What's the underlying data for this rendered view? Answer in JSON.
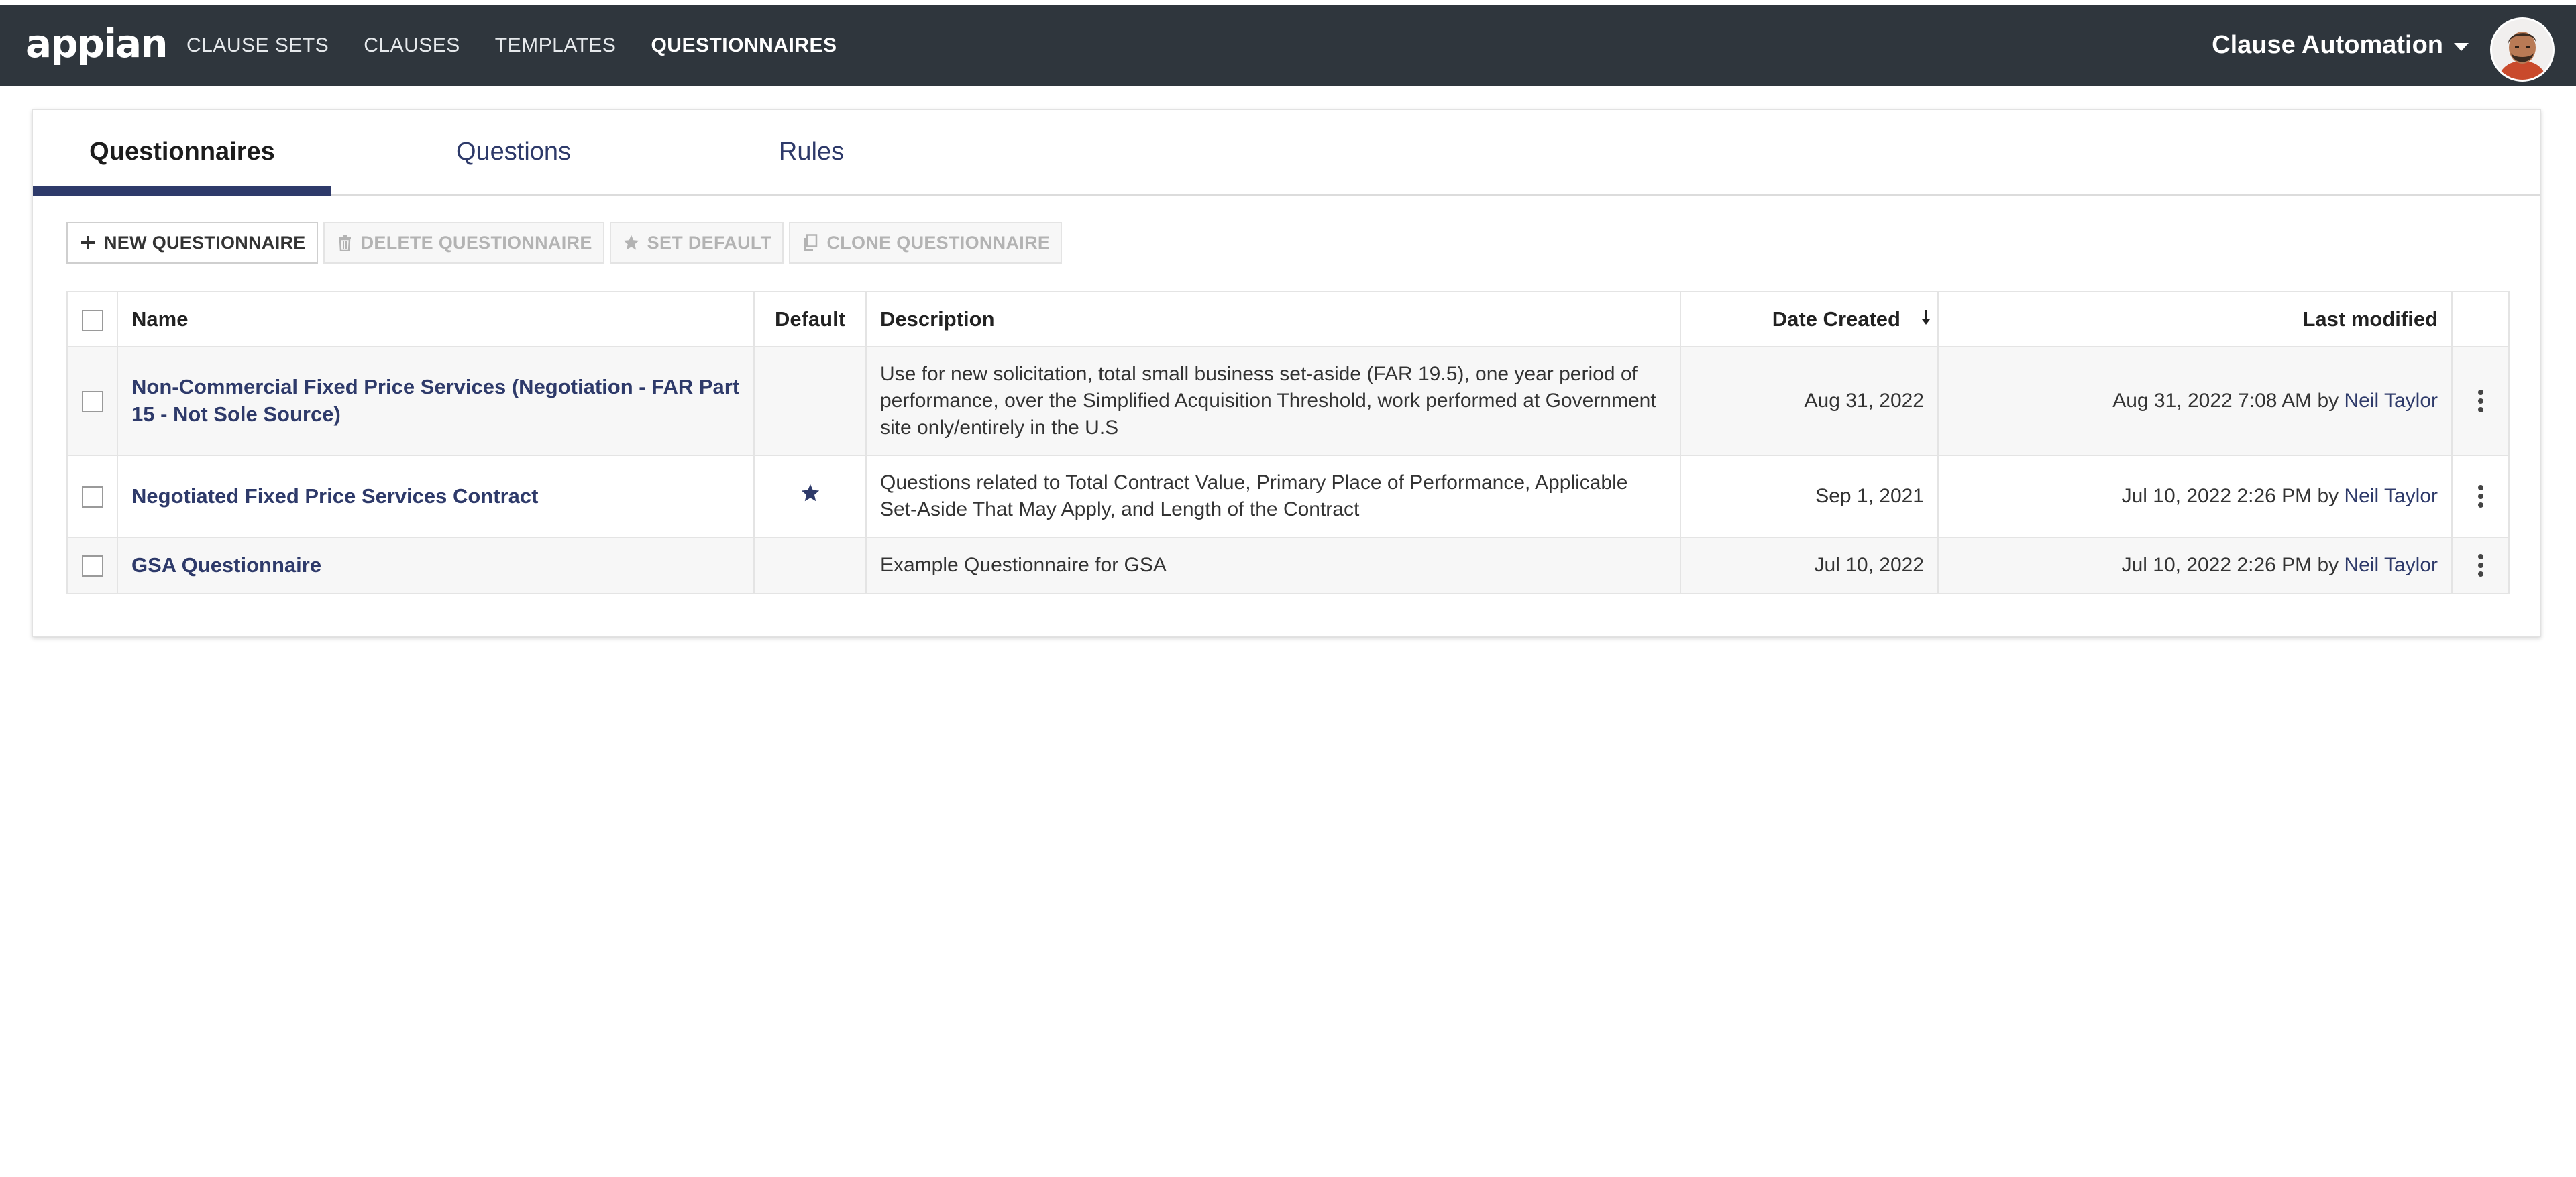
{
  "header": {
    "logo": "appian",
    "nav": [
      "CLAUSE SETS",
      "CLAUSES",
      "TEMPLATES",
      "QUESTIONNAIRES"
    ],
    "active_nav": "QUESTIONNAIRES",
    "app_name": "Clause Automation"
  },
  "tabs": [
    "Questionnaires",
    "Questions",
    "Rules"
  ],
  "active_tab": "Questionnaires",
  "toolbar": {
    "new": "NEW QUESTIONNAIRE",
    "delete": "DELETE QUESTIONNAIRE",
    "set_default": "SET DEFAULT",
    "clone": "CLONE QUESTIONNAIRE"
  },
  "table": {
    "columns": {
      "name": "Name",
      "default": "Default",
      "description": "Description",
      "date_created": "Date Created",
      "last_modified": "Last modified"
    },
    "sort": {
      "column": "Date Created",
      "direction": "descending"
    },
    "rows": [
      {
        "name": "Non-Commercial Fixed Price Services (Negotiation - FAR Part 15 - Not Sole Source)",
        "is_default": false,
        "description": "Use for new solicitation, total small business set-aside (FAR 19.5), one year period of performance, over the Simplified Acquisition Threshold, work performed at Government site only/entirely in the U.S",
        "date_created": "Aug 31, 2022",
        "modified_time": "Aug 31, 2022 7:08 AM",
        "by_label": "by",
        "modified_by": "Neil Taylor"
      },
      {
        "name": "Negotiated Fixed Price Services Contract",
        "is_default": true,
        "description": "Questions related to Total Contract Value, Primary Place of Performance, Applicable Set-Aside That May Apply, and Length of the Contract",
        "date_created": "Sep 1, 2021",
        "modified_time": "Jul 10, 2022 2:26 PM",
        "by_label": "by",
        "modified_by": "Neil Taylor"
      },
      {
        "name": "GSA Questionnaire",
        "is_default": false,
        "description": "Example Questionnaire for GSA",
        "date_created": "Jul 10, 2022",
        "modified_time": "Jul 10, 2022 2:26 PM",
        "by_label": "by",
        "modified_by": "Neil Taylor"
      }
    ]
  },
  "colors": {
    "topbar": "#2f363d",
    "accent": "#2e3a6a",
    "row_alt": "#f7f7f7"
  },
  "icons": {
    "new": "plus-icon",
    "delete": "trash-icon",
    "set_default": "star-icon",
    "clone": "copy-icon",
    "sort": "arrow-down-icon",
    "row_menu": "kebab-icon"
  }
}
